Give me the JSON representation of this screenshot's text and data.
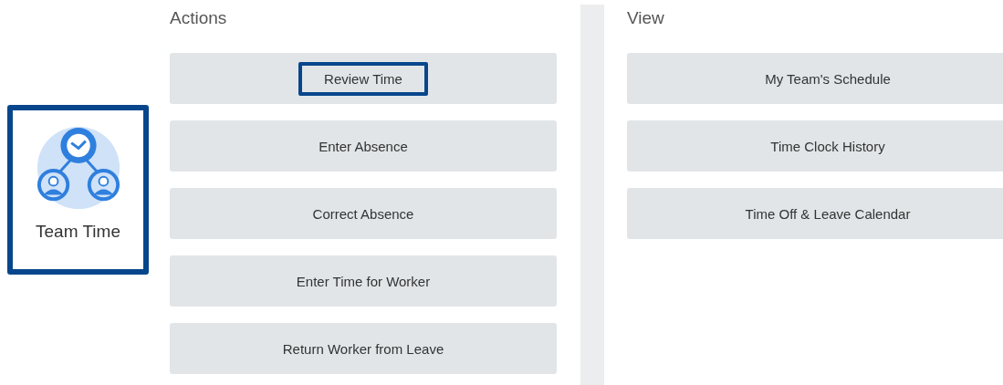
{
  "tile": {
    "label": "Team Time",
    "highlighted": true
  },
  "columns": [
    {
      "heading": "Actions",
      "buttons": [
        {
          "label": "Review Time",
          "highlighted": true
        },
        {
          "label": "Enter Absence",
          "highlighted": false
        },
        {
          "label": "Correct Absence",
          "highlighted": false
        },
        {
          "label": "Enter Time for Worker",
          "highlighted": false
        },
        {
          "label": "Return Worker from Leave",
          "highlighted": false
        }
      ]
    },
    {
      "heading": "View",
      "buttons": [
        {
          "label": "My Team's Schedule",
          "highlighted": false
        },
        {
          "label": "Time Clock History",
          "highlighted": false
        },
        {
          "label": "Time Off & Leave Calendar",
          "highlighted": false
        }
      ]
    }
  ]
}
